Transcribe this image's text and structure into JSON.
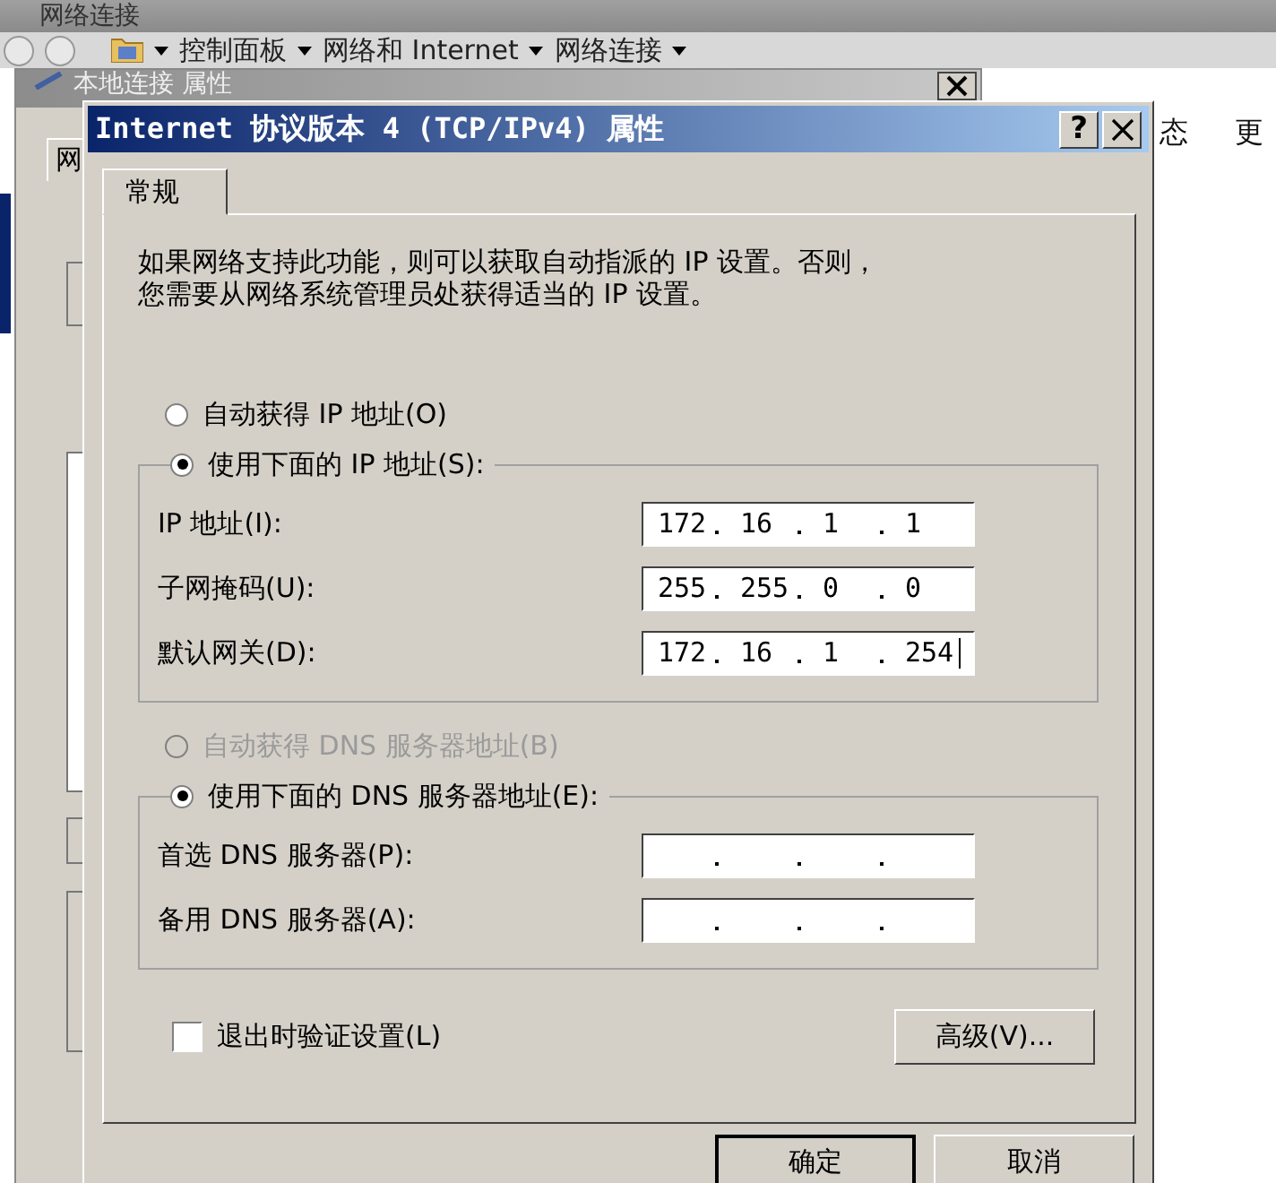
{
  "explorer": {
    "title": "网络连接",
    "breadcrumb": [
      "控制面板",
      "网络和 Internet",
      "网络连接"
    ],
    "toolbar": [
      "态",
      "更"
    ]
  },
  "properties_window": {
    "title": "本地连接 属性",
    "tab": "网"
  },
  "dialog": {
    "title": "Internet 协议版本 4 (TCP/IPv4) 属性",
    "help": "?",
    "tabs": [
      {
        "label": "常规",
        "selected": true
      }
    ],
    "intro": "如果网络支持此功能，则可以获取自动指派的 IP 设置。否则，您需要从网络系统管理员处获得适当的 IP 设置。",
    "sections": [
      {
        "options": [
          {
            "label": "自动获得 IP 地址(O)",
            "selected": false,
            "disabled": false
          },
          {
            "label": "使用下面的 IP 地址(S):",
            "selected": true,
            "disabled": false
          }
        ],
        "fields": [
          {
            "label": "IP 地址(I):",
            "octets": [
              "172",
              "16",
              "1",
              "1"
            ],
            "focused": false
          },
          {
            "label": "子网掩码(U):",
            "octets": [
              "255",
              "255",
              "0",
              "0"
            ],
            "focused": false
          },
          {
            "label": "默认网关(D):",
            "octets": [
              "172",
              "16",
              "1",
              "254"
            ],
            "focused": true
          }
        ]
      },
      {
        "options": [
          {
            "label": "自动获得 DNS 服务器地址(B)",
            "selected": false,
            "disabled": true
          },
          {
            "label": "使用下面的 DNS 服务器地址(E):",
            "selected": true,
            "disabled": false
          }
        ],
        "fields": [
          {
            "label": "首选 DNS 服务器(P):",
            "focused": false
          },
          {
            "label": "备用 DNS 服务器(A):",
            "focused": false
          }
        ]
      }
    ],
    "validate": {
      "label": "退出时验证设置(L)",
      "checked": false
    },
    "advanced": "高级(V)...",
    "buttons": [
      "确定",
      "取消"
    ]
  }
}
